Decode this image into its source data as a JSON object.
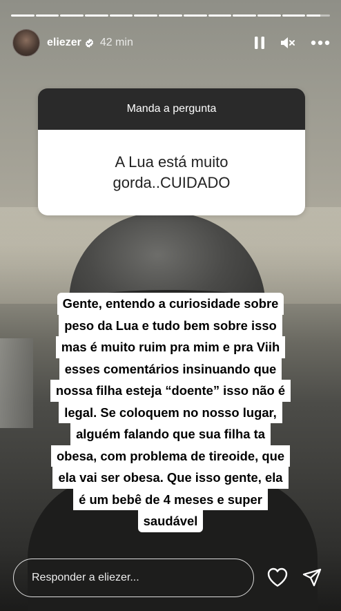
{
  "story": {
    "segments": 13,
    "current_segment": 12,
    "current_progress": 0.6
  },
  "header": {
    "username": "eliezer",
    "time_ago": "42 min",
    "icons": [
      "pause-icon",
      "muted-speaker-icon",
      "more-options-icon"
    ]
  },
  "question": {
    "prompt": "Manda a pergunta",
    "text": "A Lua está muito gorda..CUIDADO"
  },
  "caption": {
    "lines": [
      "Gente,  entendo a curiosidade sobre",
      "peso da Lua e tudo bem sobre isso",
      "mas é muito ruim pra mim e pra Viih",
      "esses comentários insinuando que",
      "nossa filha esteja “doente” isso não é",
      "legal. Se coloquem no nosso lugar,",
      "alguém falando que sua filha ta",
      "obesa, com problema de tireoide, que",
      "ela vai ser obesa. Que isso gente, ela",
      "é um bebê de 4 meses e super",
      "saudável"
    ]
  },
  "reply": {
    "placeholder": "Responder a eliezer..."
  },
  "colors": {
    "verified": "#ffffff",
    "sticker_header": "#2a2a2a"
  }
}
